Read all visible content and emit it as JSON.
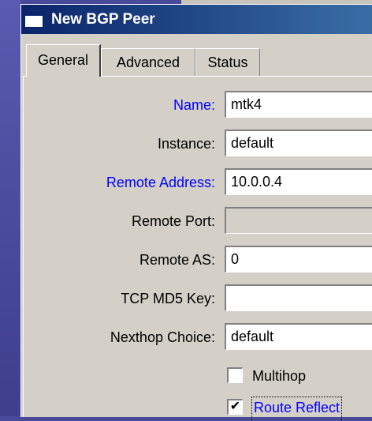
{
  "window": {
    "title": "New BGP Peer",
    "icon": "window-icon"
  },
  "tabs": [
    {
      "label": "General",
      "active": true
    },
    {
      "label": "Advanced",
      "active": false
    },
    {
      "label": "Status",
      "active": false
    }
  ],
  "form": {
    "name": {
      "label": "Name:",
      "value": "mtk4"
    },
    "instance": {
      "label": "Instance:",
      "value": "default"
    },
    "remote_address": {
      "label": "Remote Address:",
      "value": "10.0.0.4"
    },
    "remote_port": {
      "label": "Remote Port:",
      "value": ""
    },
    "remote_as": {
      "label": "Remote AS:",
      "value": "0"
    },
    "tcp_md5_key": {
      "label": "TCP MD5 Key:",
      "value": ""
    },
    "nexthop_choice": {
      "label": "Nexthop Choice:",
      "value": "default"
    },
    "multihop": {
      "label": "Multihop",
      "checked": false
    },
    "route_reflect": {
      "label": "Route Reflect",
      "checked": true
    }
  },
  "colors": {
    "title_bar_start": "#0a246a",
    "title_bar_end": "#3a6ea5",
    "window_bg": "#d4d0c8",
    "highlight_label": "#0000ff",
    "desktop": "#4a4a9c"
  }
}
